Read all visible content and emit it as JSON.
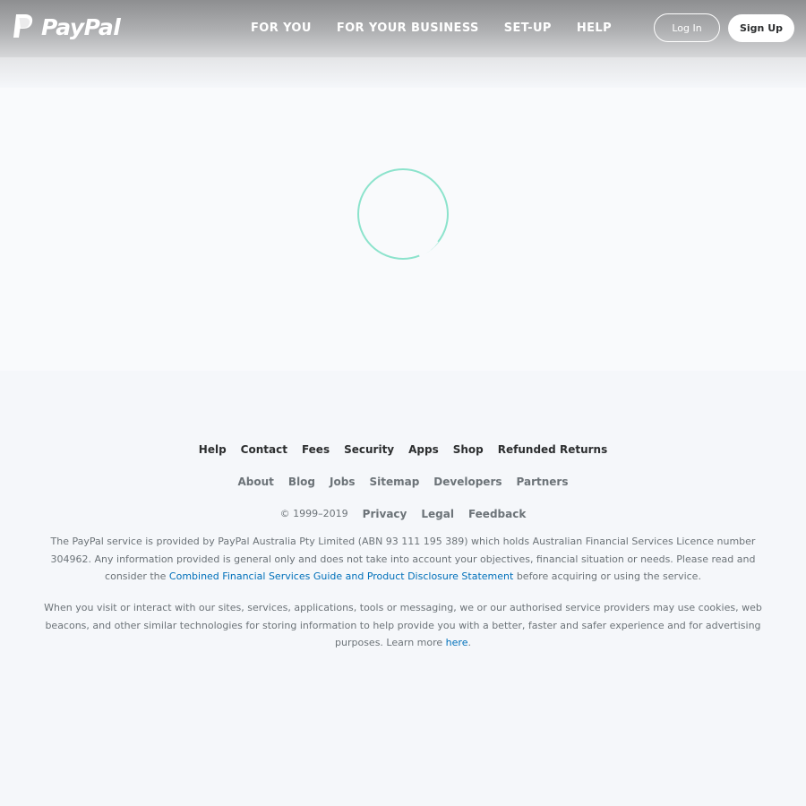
{
  "header": {
    "logo_text": "PayPal",
    "nav": [
      "FOR YOU",
      "FOR YOUR BUSINESS",
      "SET-UP",
      "HELP"
    ],
    "login_label": "Log In",
    "signup_label": "Sign Up"
  },
  "colors": {
    "accent_teal": "#7fe0c7",
    "link_blue": "#0070ba",
    "page_bg": "#f5f7fa"
  },
  "footer": {
    "primary_links": [
      "Help",
      "Contact",
      "Fees",
      "Security",
      "Apps",
      "Shop",
      "Refunded Returns"
    ],
    "secondary_links": [
      "About",
      "Blog",
      "Jobs",
      "Sitemap",
      "Developers",
      "Partners"
    ],
    "copyright": "© 1999–2019",
    "tertiary_links": [
      "Privacy",
      "Legal",
      "Feedback"
    ],
    "legal_text_1": "The PayPal service is provided by PayPal Australia Pty Limited (ABN 93 111 195 389) which holds Australian Financial Services Licence number 304962. Any information provided is general only and does not take into account your objectives, financial situation or needs. Please read and consider the",
    "legal_link_1": "Combined Financial Services Guide and Product Disclosure Statement",
    "legal_text_1_end": "before acquiring or using the service.",
    "legal_text_2": "When you visit or interact with our sites, services, applications, tools or messaging, we or our authorised service providers may use cookies, web beacons, and other similar technologies for storing information to help provide you with a better, faster and safer experience and for advertising purposes. Learn more",
    "legal_link_2": "here",
    "legal_text_2_end": "."
  }
}
